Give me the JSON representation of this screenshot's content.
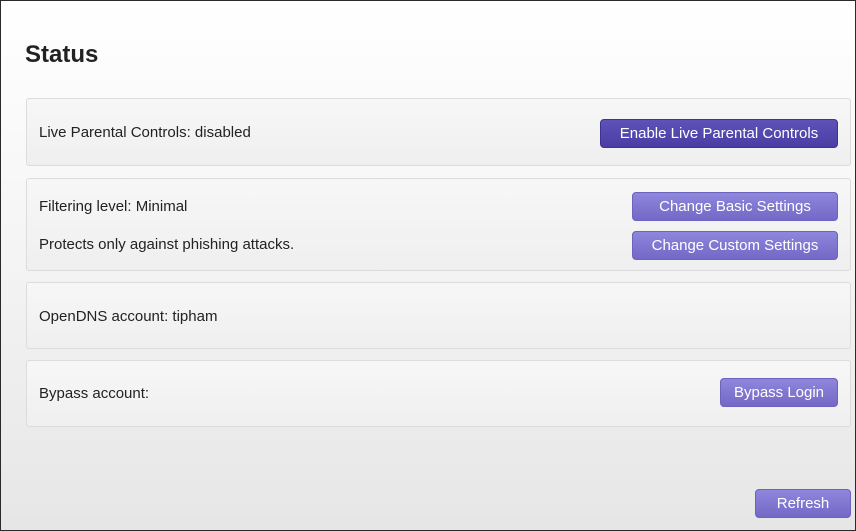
{
  "page": {
    "title": "Status"
  },
  "parental": {
    "label": "Live Parental Controls:",
    "value": "disabled",
    "button": "Enable Live Parental Controls"
  },
  "filtering": {
    "label": "Filtering level:",
    "value": "Minimal",
    "description": "Protects only against phishing attacks.",
    "basic_button": "Change Basic Settings",
    "custom_button": "Change Custom Settings"
  },
  "opendns": {
    "label": "OpenDNS account:",
    "value": "tipham"
  },
  "bypass": {
    "label": "Bypass account:",
    "button": "Bypass Login"
  },
  "footer": {
    "refresh_button": "Refresh"
  },
  "colors": {
    "button": "#7f74d1",
    "button_active": "#5346ae"
  }
}
